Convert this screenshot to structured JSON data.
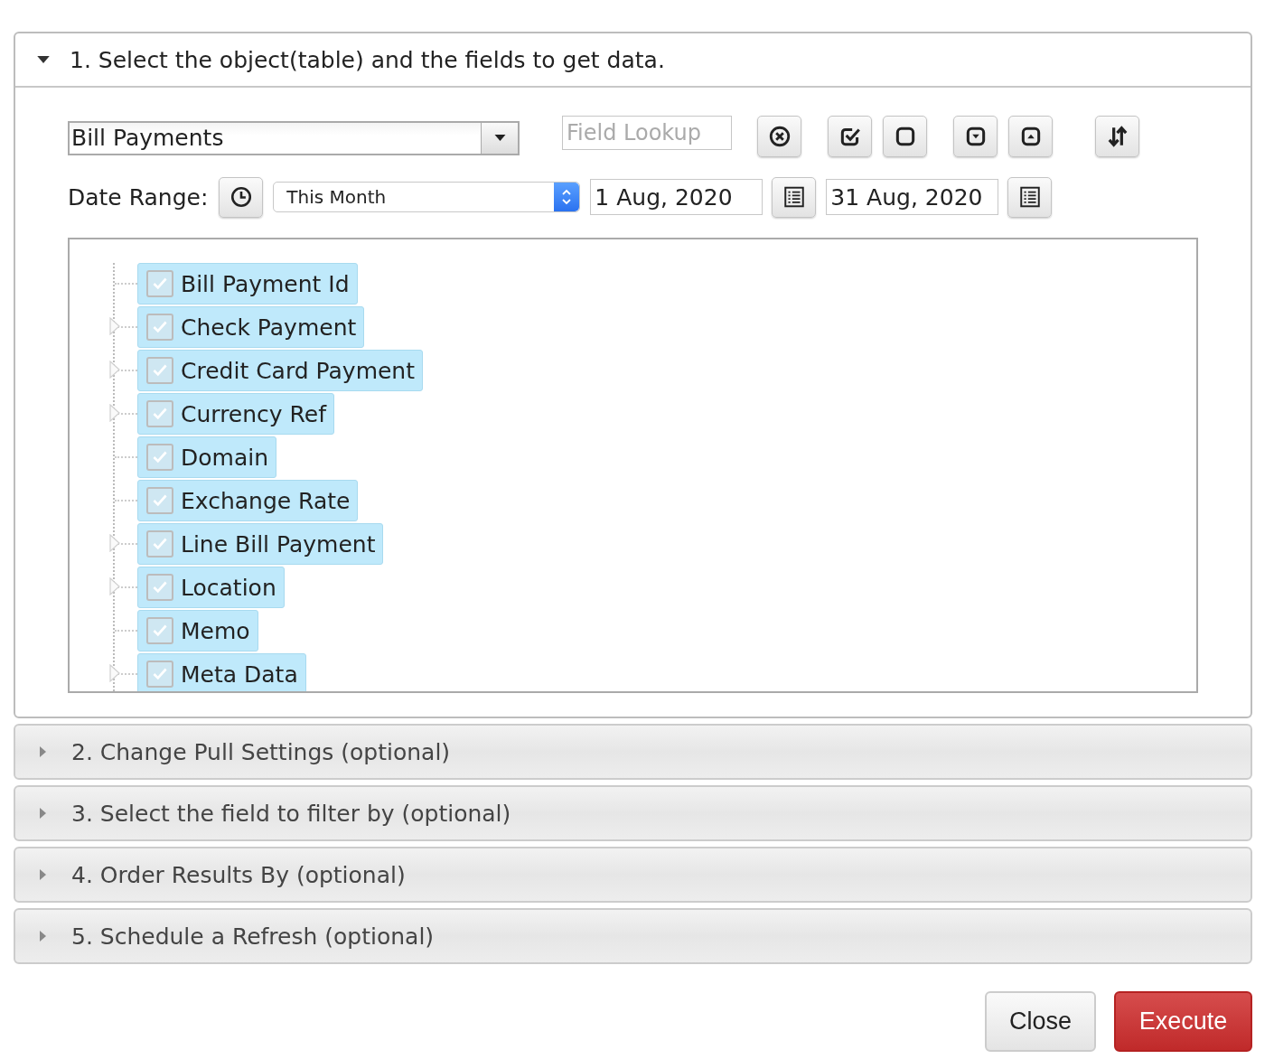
{
  "sections": [
    {
      "title": "1. Select the object(table) and the fields to get data.",
      "expanded": true
    },
    {
      "title": "2. Change Pull Settings (optional)",
      "expanded": false
    },
    {
      "title": "3. Select the field to filter by (optional)",
      "expanded": false
    },
    {
      "title": "4. Order Results By (optional)",
      "expanded": false
    },
    {
      "title": "5. Schedule a Refresh (optional)",
      "expanded": false
    }
  ],
  "object_select": {
    "value": "Bill Payments"
  },
  "field_lookup": {
    "placeholder": "Field Lookup"
  },
  "toolbar_groups": [
    [
      {
        "kind": "clear"
      }
    ],
    [
      {
        "kind": "check-all"
      },
      {
        "kind": "uncheck-all"
      }
    ],
    [
      {
        "kind": "expand"
      },
      {
        "kind": "collapse"
      }
    ],
    [
      {
        "kind": "sort"
      }
    ]
  ],
  "date_range": {
    "label": "Date Range:",
    "preset": "This Month",
    "start": "1 Aug, 2020",
    "end": "31 Aug, 2020"
  },
  "fields": [
    {
      "label": "Bill Payment Id",
      "checked": true,
      "expandable": false
    },
    {
      "label": "Check Payment",
      "checked": true,
      "expandable": true
    },
    {
      "label": "Credit Card Payment",
      "checked": true,
      "expandable": true
    },
    {
      "label": "Currency Ref",
      "checked": true,
      "expandable": true
    },
    {
      "label": "Domain",
      "checked": true,
      "expandable": false
    },
    {
      "label": "Exchange Rate",
      "checked": true,
      "expandable": false
    },
    {
      "label": "Line Bill Payment",
      "checked": true,
      "expandable": true
    },
    {
      "label": "Location",
      "checked": true,
      "expandable": true
    },
    {
      "label": "Memo",
      "checked": true,
      "expandable": false
    },
    {
      "label": "Meta Data",
      "checked": true,
      "expandable": true
    }
  ],
  "buttons": [
    {
      "label": "Close",
      "kind": "default"
    },
    {
      "label": "Execute",
      "kind": "danger"
    }
  ]
}
